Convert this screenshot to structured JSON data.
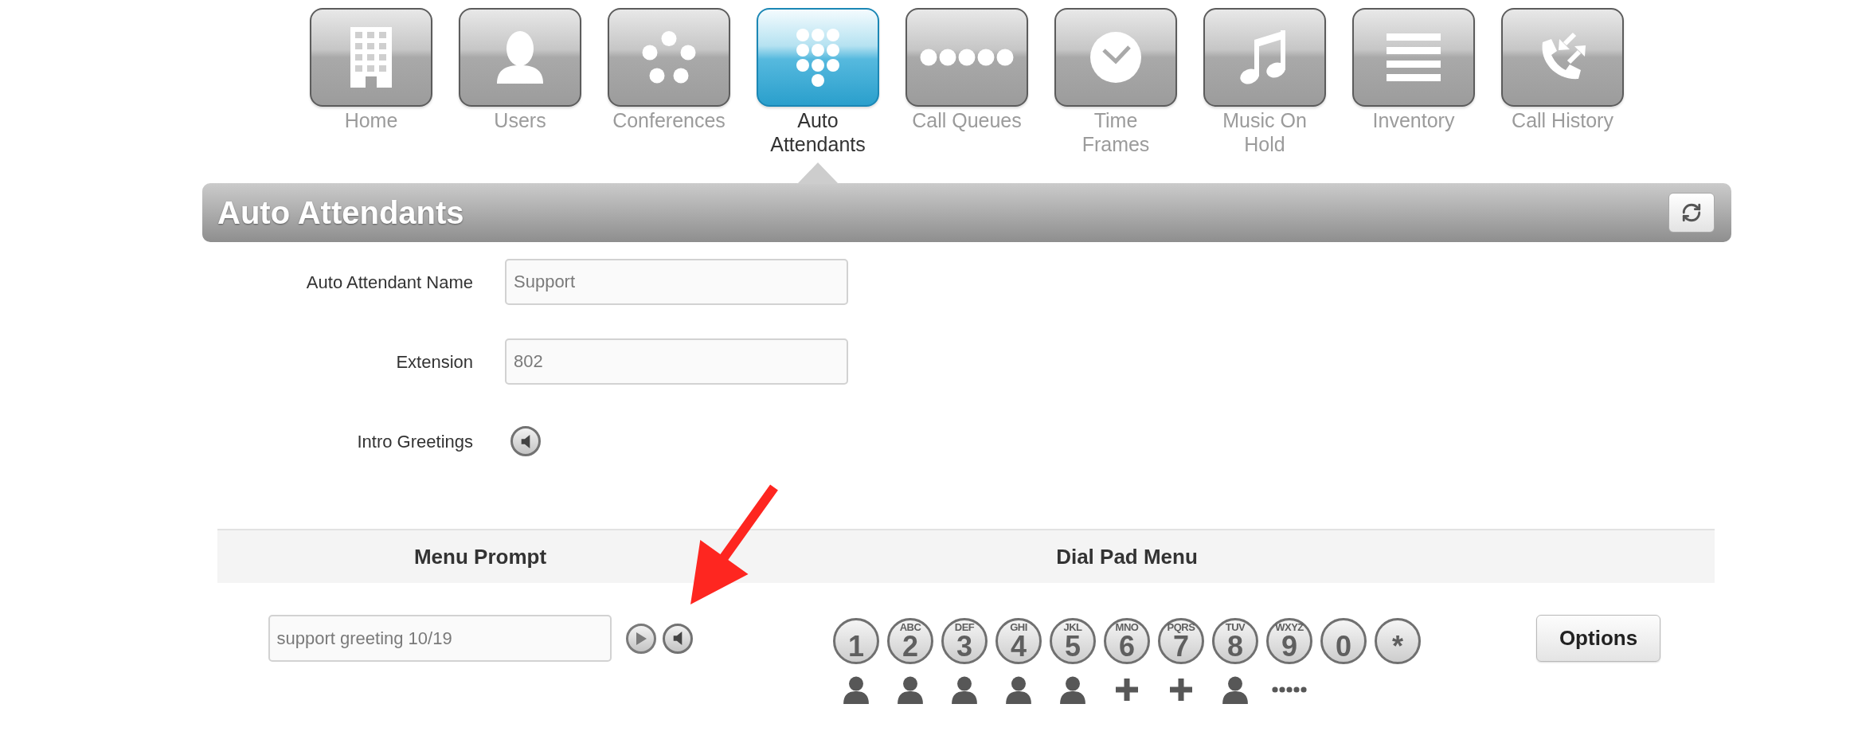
{
  "nav": [
    {
      "label": "Home",
      "selected": false
    },
    {
      "label": "Users",
      "selected": false
    },
    {
      "label": "Conferences",
      "selected": false
    },
    {
      "label": "Auto Attendants",
      "selected": true
    },
    {
      "label": "Call Queues",
      "selected": false
    },
    {
      "label": "Time Frames",
      "selected": false
    },
    {
      "label": "Music On Hold",
      "selected": false
    },
    {
      "label": "Inventory",
      "selected": false
    },
    {
      "label": "Call History",
      "selected": false
    }
  ],
  "header": {
    "title": "Auto Attendants"
  },
  "form": [
    {
      "kind": "text",
      "label": "Auto Attendant Name",
      "value": "Support"
    },
    {
      "kind": "text",
      "label": "Extension",
      "value": "802"
    },
    {
      "kind": "audio",
      "label": "Intro Greetings"
    }
  ],
  "menu": {
    "columns": [
      "Menu Prompt",
      "Dial Pad Menu"
    ],
    "prompt": {
      "value": "support greeting 10/19"
    },
    "keys": [
      {
        "digit": "1",
        "kind": "user"
      },
      {
        "digit": "2",
        "letters": "ABC",
        "kind": "user"
      },
      {
        "digit": "3",
        "letters": "DEF",
        "kind": "user"
      },
      {
        "digit": "4",
        "letters": "GHI",
        "kind": "user"
      },
      {
        "digit": "5",
        "letters": "JKL",
        "kind": "user"
      },
      {
        "digit": "6",
        "letters": "MNO",
        "kind": "add"
      },
      {
        "digit": "7",
        "letters": "PQRS",
        "kind": "add"
      },
      {
        "digit": "8",
        "letters": "TUV",
        "kind": "user"
      },
      {
        "digit": "9",
        "letters": "WXYZ",
        "kind": "more"
      },
      {
        "digit": "0"
      },
      {
        "digit": "*"
      }
    ],
    "options_button": "Options"
  }
}
